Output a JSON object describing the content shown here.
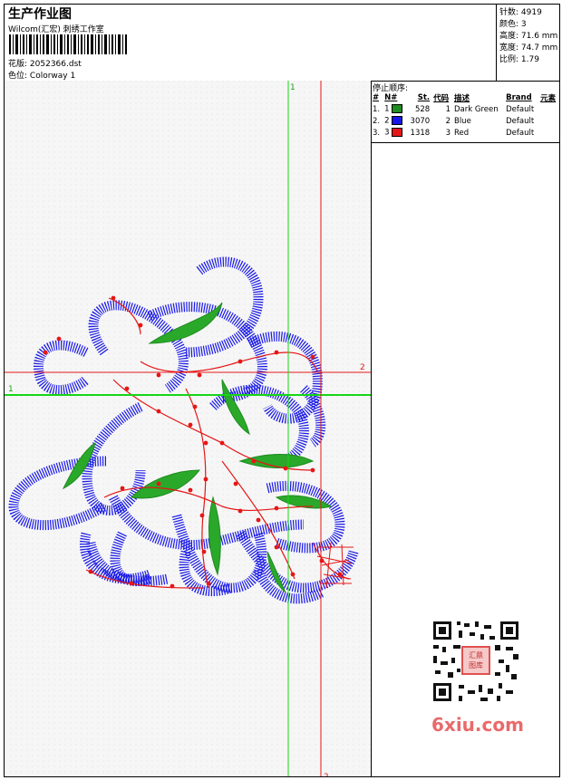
{
  "header": {
    "title": "生产作业图",
    "studio": "Wilcom(汇宏) 刺绣工作室",
    "pattern_label": "花版:",
    "pattern_value": "2052366.dst",
    "colorway_label": "色位:",
    "colorway_value": "Colorway 1"
  },
  "stats": {
    "stitches": "针数: 4919",
    "colors": "颜色: 3",
    "height": "高度: 71.6 mm",
    "width": "宽度: 74.7 mm",
    "ratio": "比例: 1.79"
  },
  "stop_sequence": {
    "title": "停止顺序:",
    "headers": [
      "#",
      "N#",
      "St.",
      "代码",
      "描述",
      "Brand",
      "元素"
    ],
    "rows": [
      {
        "index": "1.",
        "needle": "1",
        "color": "#1e8c1e",
        "stitches": "528",
        "code": "1",
        "desc": "Dark Green",
        "brand": "Default"
      },
      {
        "index": "2.",
        "needle": "2",
        "color": "#1616e6",
        "stitches": "3070",
        "code": "2",
        "desc": "Blue",
        "brand": "Default"
      },
      {
        "index": "3.",
        "needle": "3",
        "color": "#e61616",
        "stitches": "1318",
        "code": "3",
        "desc": "Red",
        "brand": "Default"
      }
    ]
  },
  "markers": {
    "h1": "1",
    "h2": "2",
    "v1": "1",
    "v2": "2"
  },
  "watermark": "6xiu.com",
  "qr_stamp": "汇鼎图库"
}
